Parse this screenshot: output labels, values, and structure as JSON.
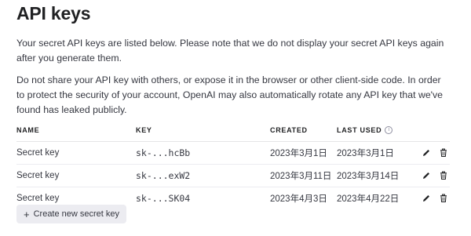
{
  "page": {
    "title": "API keys",
    "paragraph_1": "Your secret API keys are listed below. Please note that we do not display your secret API keys again after you generate them.",
    "paragraph_2": "Do not share your API key with others, or expose it in the browser or other client-side code. In order to protect the security of your account, OpenAI may also automatically rotate any API key that we've found has leaked publicly."
  },
  "table": {
    "headers": {
      "name": "NAME",
      "key": "KEY",
      "created": "CREATED",
      "last_used": "LAST USED"
    },
    "last_used_info_icon": "info-icon",
    "rows": [
      {
        "name": "Secret key",
        "key": "sk-...hcBb",
        "created": "2023年3月1日",
        "last_used": "2023年3月1日"
      },
      {
        "name": "Secret key",
        "key": "sk-...exW2",
        "created": "2023年3月11日",
        "last_used": "2023年3月14日"
      },
      {
        "name": "Secret key",
        "key": "sk-...SK04",
        "created": "2023年4月3日",
        "last_used": "2023年4月22日"
      }
    ],
    "row_action_icons": [
      "pencil-icon",
      "trash-icon"
    ]
  },
  "create_button": {
    "icon": "plus-icon",
    "label": "Create new secret key"
  },
  "colors": {
    "text": "#353740",
    "heading": "#202123",
    "button_bg": "#ececf1",
    "divider": "#ececf1"
  }
}
